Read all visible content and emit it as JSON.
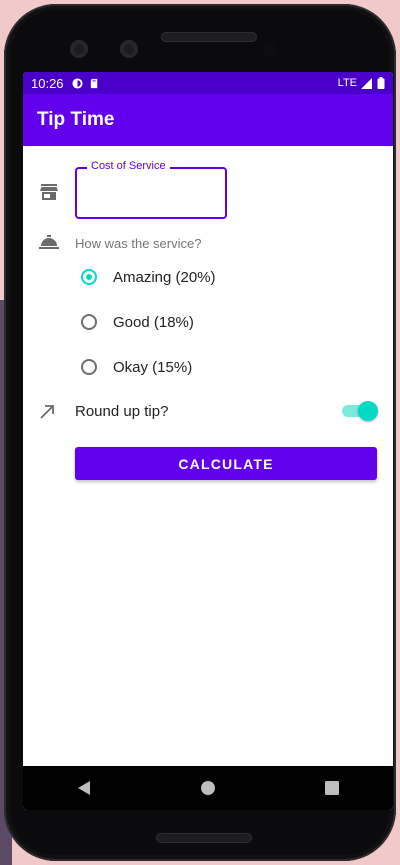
{
  "status_bar": {
    "time": "10:26",
    "network": "LTE"
  },
  "app_bar": {
    "title": "Tip Time"
  },
  "form": {
    "cost_label": "Cost of Service",
    "cost_value": "",
    "service_question": "How was the service?",
    "options": [
      {
        "label": "Amazing (20%)",
        "selected": true
      },
      {
        "label": "Good (18%)",
        "selected": false
      },
      {
        "label": "Okay (15%)",
        "selected": false
      }
    ],
    "round_up_label": "Round up tip?",
    "round_up_on": true,
    "calculate_label": "CALCULATE"
  },
  "colors": {
    "primary": "#6200ee",
    "status_bar": "#4a00c9",
    "accent": "#03dac5"
  },
  "icons": [
    "store-icon",
    "room-service-icon",
    "trending-up-icon",
    "back-nav-icon",
    "home-nav-icon",
    "recents-nav-icon"
  ]
}
